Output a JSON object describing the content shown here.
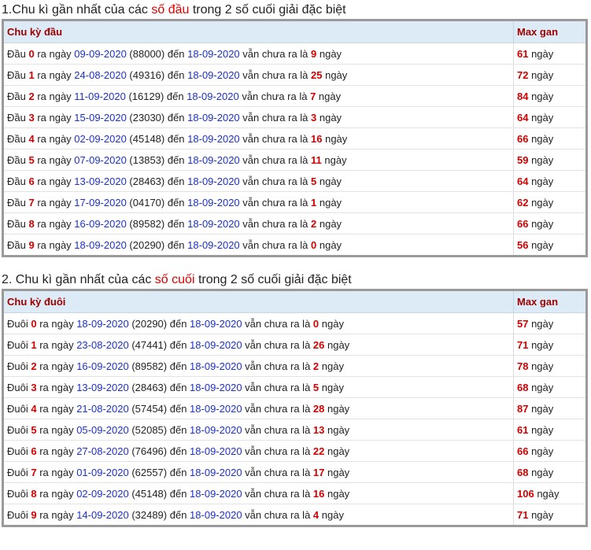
{
  "section1": {
    "heading_prefix": "1.Chu kì gần nhất của các ",
    "heading_highlight": "số đầu",
    "heading_suffix": " trong 2 số cuối giải đặc biệt",
    "col_label": "Chu kỳ đầu",
    "col_gan": "Max gan",
    "rows": [
      {
        "prefix": "Đầu ",
        "digit": "0",
        "date": "09-09-2020",
        "code": "(88000)",
        "end": "18-09-2020",
        "gap": "9",
        "max": "61"
      },
      {
        "prefix": "Đầu ",
        "digit": "1",
        "date": "24-08-2020",
        "code": "(49316)",
        "end": "18-09-2020",
        "gap": "25",
        "max": "72"
      },
      {
        "prefix": "Đầu ",
        "digit": "2",
        "date": "11-09-2020",
        "code": "(16129)",
        "end": "18-09-2020",
        "gap": "7",
        "max": "84"
      },
      {
        "prefix": "Đầu ",
        "digit": "3",
        "date": "15-09-2020",
        "code": "(23030)",
        "end": "18-09-2020",
        "gap": "3",
        "max": "64"
      },
      {
        "prefix": "Đầu ",
        "digit": "4",
        "date": "02-09-2020",
        "code": "(45148)",
        "end": "18-09-2020",
        "gap": "16",
        "max": "66"
      },
      {
        "prefix": "Đầu ",
        "digit": "5",
        "date": "07-09-2020",
        "code": "(13853)",
        "end": "18-09-2020",
        "gap": "11",
        "max": "59"
      },
      {
        "prefix": "Đầu ",
        "digit": "6",
        "date": "13-09-2020",
        "code": "(28463)",
        "end": "18-09-2020",
        "gap": "5",
        "max": "64"
      },
      {
        "prefix": "Đầu ",
        "digit": "7",
        "date": "17-09-2020",
        "code": "(04170)",
        "end": "18-09-2020",
        "gap": "1",
        "max": "62"
      },
      {
        "prefix": "Đầu ",
        "digit": "8",
        "date": "16-09-2020",
        "code": "(89582)",
        "end": "18-09-2020",
        "gap": "2",
        "max": "66"
      },
      {
        "prefix": "Đầu ",
        "digit": "9",
        "date": "18-09-2020",
        "code": "(20290)",
        "end": "18-09-2020",
        "gap": "0",
        "max": "56"
      }
    ]
  },
  "section2": {
    "heading_prefix": "2. Chu kì gần nhất của các ",
    "heading_highlight": "số cuối",
    "heading_suffix": " trong 2 số cuối giải đặc biệt",
    "col_label": "Chu kỳ đuôi",
    "col_gan": "Max gan",
    "rows": [
      {
        "prefix": "Đuôi ",
        "digit": "0",
        "date": "18-09-2020",
        "code": "(20290)",
        "end": "18-09-2020",
        "gap": "0",
        "max": "57"
      },
      {
        "prefix": "Đuôi ",
        "digit": "1",
        "date": "23-08-2020",
        "code": "(47441)",
        "end": "18-09-2020",
        "gap": "26",
        "max": "71"
      },
      {
        "prefix": "Đuôi ",
        "digit": "2",
        "date": "16-09-2020",
        "code": "(89582)",
        "end": "18-09-2020",
        "gap": "2",
        "max": "78"
      },
      {
        "prefix": "Đuôi ",
        "digit": "3",
        "date": "13-09-2020",
        "code": "(28463)",
        "end": "18-09-2020",
        "gap": "5",
        "max": "68"
      },
      {
        "prefix": "Đuôi ",
        "digit": "4",
        "date": "21-08-2020",
        "code": "(57454)",
        "end": "18-09-2020",
        "gap": "28",
        "max": "87"
      },
      {
        "prefix": "Đuôi ",
        "digit": "5",
        "date": "05-09-2020",
        "code": "(52085)",
        "end": "18-09-2020",
        "gap": "13",
        "max": "61"
      },
      {
        "prefix": "Đuôi ",
        "digit": "6",
        "date": "27-08-2020",
        "code": "(76496)",
        "end": "18-09-2020",
        "gap": "22",
        "max": "66"
      },
      {
        "prefix": "Đuôi ",
        "digit": "7",
        "date": "01-09-2020",
        "code": "(62557)",
        "end": "18-09-2020",
        "gap": "17",
        "max": "68"
      },
      {
        "prefix": "Đuôi ",
        "digit": "8",
        "date": "02-09-2020",
        "code": "(45148)",
        "end": "18-09-2020",
        "gap": "16",
        "max": "106"
      },
      {
        "prefix": "Đuôi ",
        "digit": "9",
        "date": "14-09-2020",
        "code": "(32489)",
        "end": "18-09-2020",
        "gap": "4",
        "max": "71"
      }
    ]
  },
  "labels": {
    "ra_ngay": " ra ngày ",
    "den": " đến ",
    "van_chua": " vẫn chưa ra là ",
    "ngay": " ngày"
  },
  "colors": {
    "highlight": "#d40000",
    "date_blue": "#1d31c9",
    "header_bg": "#dcebf6",
    "header_text": "#a00000",
    "panel_border": "#9a9a9a"
  }
}
